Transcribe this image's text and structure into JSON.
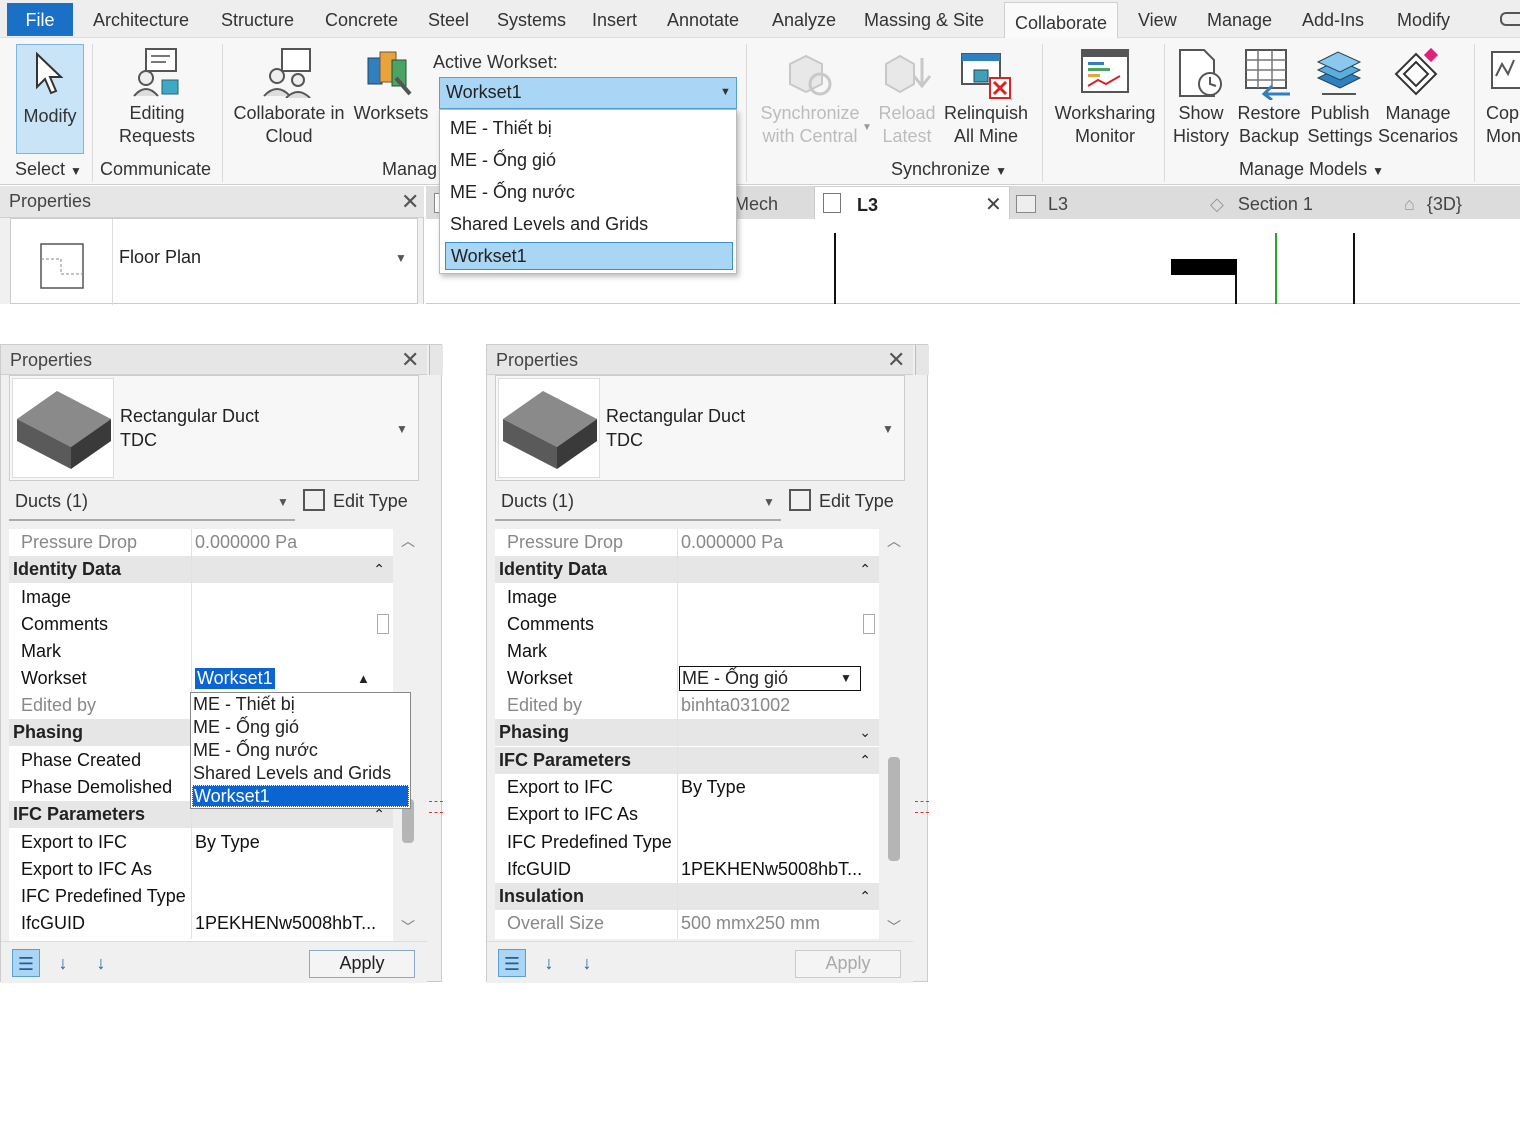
{
  "menu": {
    "file": "File",
    "tabs": [
      "Architecture",
      "Structure",
      "Concrete",
      "Steel",
      "Systems",
      "Insert",
      "Annotate",
      "Analyze",
      "Massing & Site",
      "Collaborate",
      "View",
      "Manage",
      "Add-Ins",
      "Modify"
    ],
    "active": "Collaborate"
  },
  "ribbon": {
    "modify": "Modify",
    "select": "Select",
    "editing_requests": [
      "Editing",
      "Requests"
    ],
    "communicate": "Communicate",
    "collab_cloud": [
      "Collaborate in",
      "Cloud"
    ],
    "worksets": "Worksets",
    "manage_panel": "Manag",
    "active_workset_label": "Active Workset:",
    "active_workset_value": "Workset1",
    "workset_options": [
      "ME - Thiết bị",
      "ME - Ống gió",
      "ME - Ống nước",
      "Shared Levels and Grids",
      "Workset1"
    ],
    "sync_central": [
      "Synchronize",
      "with Central"
    ],
    "reload_latest": [
      "Reload",
      "Latest"
    ],
    "relinquish": [
      "Relinquish",
      "All Mine"
    ],
    "synchronize_panel": "Synchronize",
    "worksharing_monitor": [
      "Worksharing",
      "Monitor"
    ],
    "show_history": [
      "Show",
      "History"
    ],
    "restore_backup": [
      "Restore",
      "Backup"
    ],
    "publish_settings": [
      "Publish",
      "Settings"
    ],
    "manage_scenarios": [
      "Manage",
      "Scenarios"
    ],
    "manage_models_panel": "Manage Models",
    "copy_monitor": [
      "Cop",
      "Mon"
    ]
  },
  "top_properties": {
    "title": "Properties",
    "type": "Floor Plan"
  },
  "view_tabs": [
    "Mech",
    "L3",
    "L3",
    "Section 1",
    "{3D}"
  ],
  "left_panel": {
    "title": "Properties",
    "family": "Rectangular Duct",
    "type": "TDC",
    "selector": "Ducts (1)",
    "edit_type": "Edit Type",
    "rows": {
      "pressure_drop_k": "Pressure Drop",
      "pressure_drop_v": "0.000000 Pa",
      "identity": "Identity Data",
      "image": "Image",
      "comments": "Comments",
      "mark": "Mark",
      "workset_k": "Workset",
      "workset_v": "Workset1",
      "edited_by": "Edited by",
      "phasing": "Phasing",
      "phase_created": "Phase Created",
      "phase_demolished": "Phase Demolished",
      "ifc": "IFC Parameters",
      "export_ifc_k": "Export to IFC",
      "export_ifc_v": "By Type",
      "export_ifc_as": "Export to IFC As",
      "ifc_predef": "IFC Predefined Type",
      "ifcguid_k": "IfcGUID",
      "ifcguid_v": "1PEKHENw5008hbT..."
    },
    "dropdown_options": [
      "ME - Thiết bị",
      "ME - Ống gió",
      "ME - Ống nước",
      "Shared Levels and Grids",
      "Workset1"
    ],
    "apply": "Apply"
  },
  "right_panel": {
    "title": "Properties",
    "family": "Rectangular Duct",
    "type": "TDC",
    "selector": "Ducts (1)",
    "edit_type": "Edit Type",
    "rows": {
      "pressure_drop_k": "Pressure Drop",
      "pressure_drop_v": "0.000000 Pa",
      "identity": "Identity Data",
      "image": "Image",
      "comments": "Comments",
      "mark": "Mark",
      "workset_k": "Workset",
      "workset_v": "ME - Ống gió",
      "edited_by_k": "Edited by",
      "edited_by_v": "binhta031002",
      "phasing": "Phasing",
      "ifc": "IFC Parameters",
      "export_ifc_k": "Export to IFC",
      "export_ifc_v": "By Type",
      "export_ifc_as": "Export to IFC As",
      "ifc_predef": "IFC Predefined Type",
      "ifcguid_k": "IfcGUID",
      "ifcguid_v": "1PEKHENw5008hbT...",
      "insulation": "Insulation",
      "overall_k": "Overall Size",
      "overall_v": "500 mmx250 mm"
    },
    "apply": "Apply"
  },
  "colors": {
    "accent": "#1a6fc7",
    "selection": "#0a64d2",
    "dropdown_fill": "#a9d6f5"
  }
}
